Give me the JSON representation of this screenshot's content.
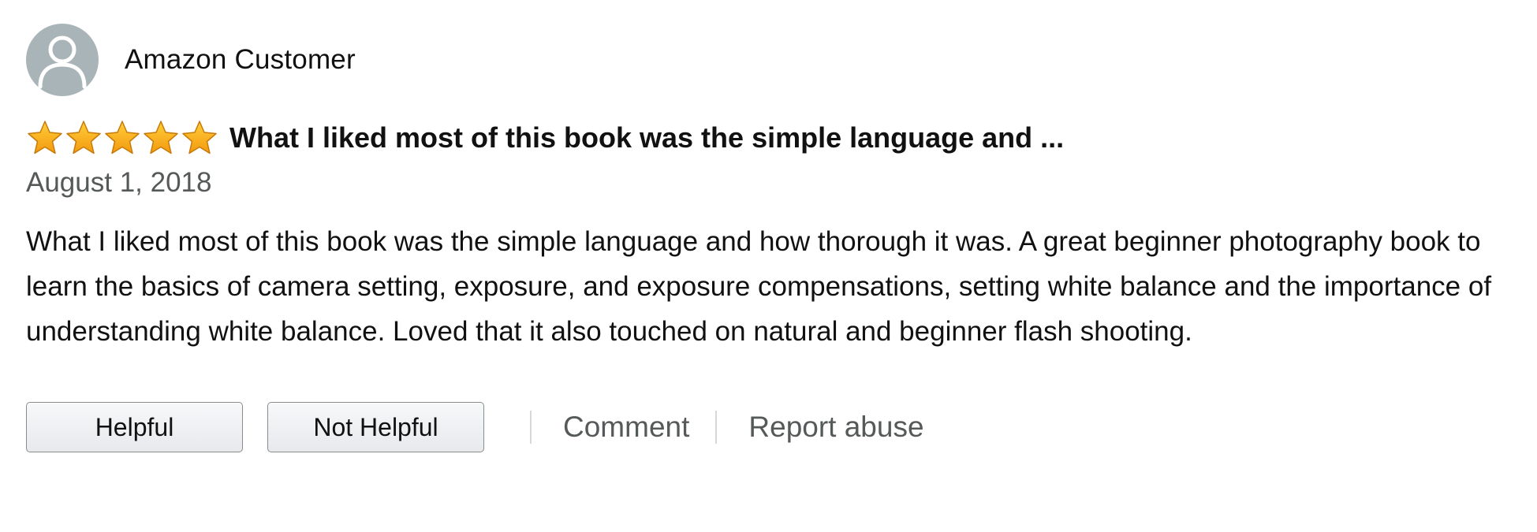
{
  "profile": {
    "name": "Amazon Customer",
    "avatar_icon": "user-silhouette-icon",
    "avatar_color": "#a9b4b8"
  },
  "review": {
    "rating": 5,
    "rating_max": 5,
    "star_color": "#ffa41c",
    "title": "What I liked most of this book was the simple language and ...",
    "date": "August 1, 2018",
    "body": "What I liked most of this book was the simple language and how thorough it was. A great beginner photography book to learn the basics of camera setting, exposure, and exposure compensations, setting white balance and the importance of understanding white balance. Loved that it also touched on natural and beginner flash shooting."
  },
  "actions": {
    "helpful_label": "Helpful",
    "not_helpful_label": "Not Helpful",
    "comment_label": "Comment",
    "report_label": "Report abuse"
  }
}
